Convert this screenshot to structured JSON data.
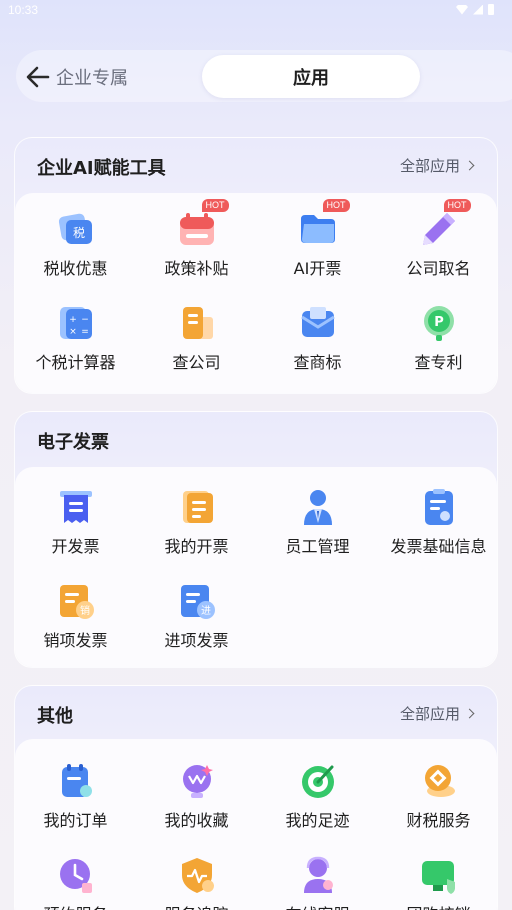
{
  "status_bar": {
    "time": "10:33"
  },
  "top_nav": {
    "back_label": "企业专属",
    "active_tab": "应用"
  },
  "sections": {
    "ai_tools": {
      "title": "企业AI赋能工具",
      "link": "全部应用",
      "items": [
        {
          "label": "税收优惠",
          "icon": "tax-icon",
          "badge": ""
        },
        {
          "label": "政策补贴",
          "icon": "calendar-gift-icon",
          "badge": "HOT"
        },
        {
          "label": "AI开票",
          "icon": "folder-icon",
          "badge": "HOT"
        },
        {
          "label": "公司取名",
          "icon": "pen-icon",
          "badge": "HOT"
        },
        {
          "label": "个税计算器",
          "icon": "calculator-icon",
          "badge": ""
        },
        {
          "label": "查公司",
          "icon": "building-icon",
          "badge": ""
        },
        {
          "label": "查商标",
          "icon": "trademark-envelope-icon",
          "badge": ""
        },
        {
          "label": "查专利",
          "icon": "patent-icon",
          "badge": ""
        }
      ]
    },
    "e_invoice": {
      "title": "电子发票",
      "items": [
        {
          "label": "开发票",
          "icon": "invoice-print-icon"
        },
        {
          "label": "我的开票",
          "icon": "scroll-icon"
        },
        {
          "label": "员工管理",
          "icon": "employee-icon"
        },
        {
          "label": "发票基础信息",
          "icon": "invoice-settings-icon"
        },
        {
          "label": "销项发票",
          "icon": "sales-invoice-icon"
        },
        {
          "label": "进项发票",
          "icon": "purchase-invoice-icon"
        }
      ]
    },
    "other": {
      "title": "其他",
      "link": "全部应用",
      "items": [
        {
          "label": "我的订单",
          "icon": "order-icon"
        },
        {
          "label": "我的收藏",
          "icon": "favorite-icon"
        },
        {
          "label": "我的足迹",
          "icon": "footprint-icon"
        },
        {
          "label": "财税服务",
          "icon": "finance-service-icon"
        },
        {
          "label": "预约服务",
          "icon": "appointment-icon"
        },
        {
          "label": "服务追踪",
          "icon": "service-tracking-icon"
        },
        {
          "label": "在线客服",
          "icon": "customer-service-icon"
        },
        {
          "label": "团购核销",
          "icon": "group-buy-icon"
        }
      ]
    }
  },
  "colors": {
    "blue": "#4a86f0",
    "red": "#ef5a5a",
    "orange": "#f3a535",
    "green": "#35c86a",
    "purple": "#9a72f0"
  }
}
